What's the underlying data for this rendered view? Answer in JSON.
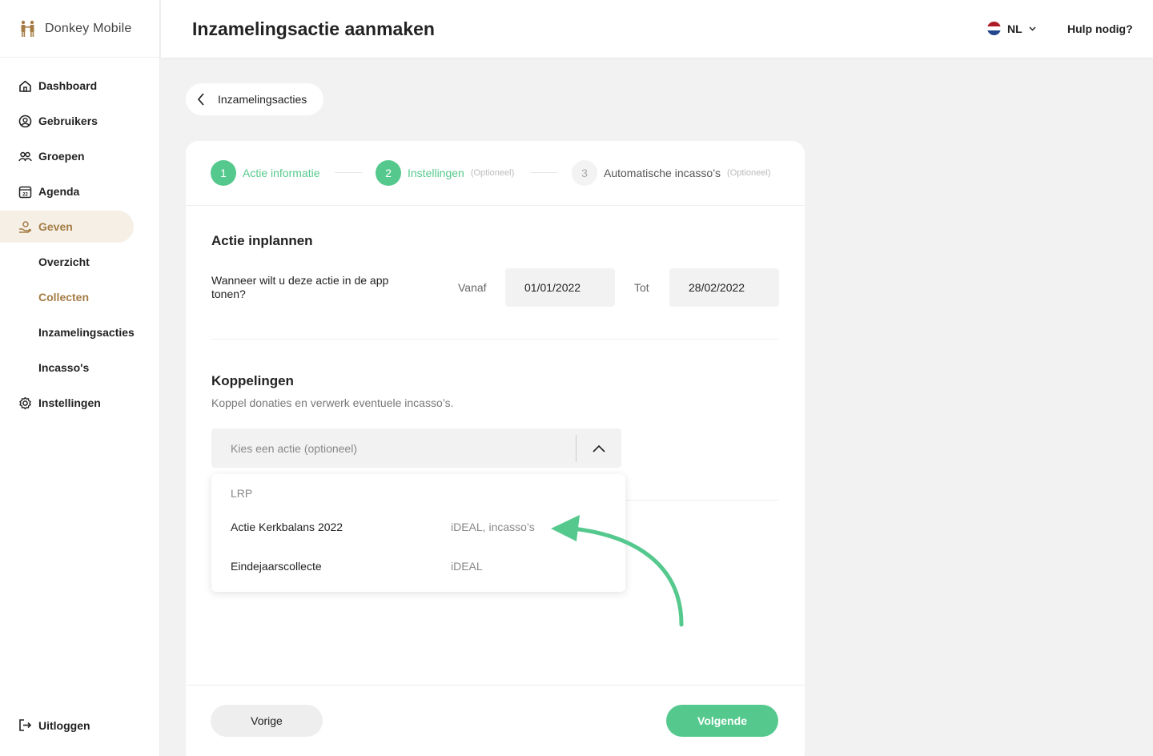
{
  "brand": {
    "name": "Donkey Mobile",
    "accent": "#a57c45",
    "green": "#55c98d"
  },
  "sidebar": {
    "items": [
      {
        "label": "Dashboard",
        "icon": "home-icon"
      },
      {
        "label": "Gebruikers",
        "icon": "user-circle-icon"
      },
      {
        "label": "Groepen",
        "icon": "group-icon"
      },
      {
        "label": "Agenda",
        "icon": "calendar-icon"
      },
      {
        "label": "Geven",
        "icon": "giving-hand-icon",
        "active": true
      },
      {
        "label": "Overzicht",
        "sub": true
      },
      {
        "label": "Collecten",
        "sub": true,
        "current": true
      },
      {
        "label": "Inzamelingsacties",
        "sub": true
      },
      {
        "label": "Incasso's",
        "sub": true
      },
      {
        "label": "Instellingen",
        "icon": "gear-icon"
      }
    ],
    "logout": "Uitloggen"
  },
  "header": {
    "title": "Inzamelingsactie aanmaken",
    "language": "NL",
    "help": "Hulp nodig?"
  },
  "back": {
    "label": "Inzamelingsacties"
  },
  "steps": [
    {
      "num": "1",
      "label": "Actie informatie",
      "optional": ""
    },
    {
      "num": "2",
      "label": "Instellingen",
      "optional": "(Optioneel)"
    },
    {
      "num": "3",
      "label": "Automatische incasso’s",
      "optional": "(Optioneel)"
    }
  ],
  "schedule": {
    "title": "Actie inplannen",
    "question": "Wanneer wilt u deze actie in de app tonen?",
    "from_label": "Vanaf",
    "from_value": "01/01/2022",
    "to_label": "Tot",
    "to_value": "28/02/2022"
  },
  "links": {
    "title": "Koppelingen",
    "subtitle": "Koppel donaties en verwerk eventuele incasso’s.",
    "select_placeholder": "Kies een actie (optioneel)",
    "dropdown": {
      "group": "LRP",
      "options": [
        {
          "name": "Actie Kerkbalans 2022",
          "meta": "iDEAL, incasso’s"
        },
        {
          "name": "Eindejaarscollecte",
          "meta": "iDEAL"
        }
      ]
    }
  },
  "footer": {
    "prev": "Vorige",
    "next": "Volgende"
  }
}
